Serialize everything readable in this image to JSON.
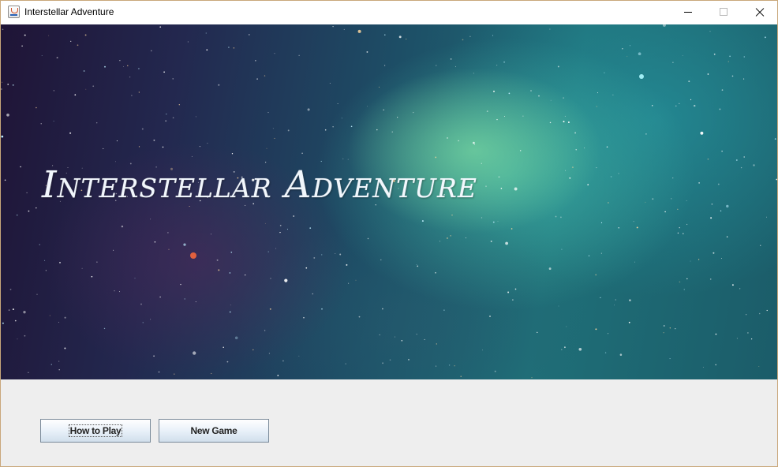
{
  "window": {
    "title": "Interstellar Adventure",
    "icon": "java-cup-icon",
    "controls": [
      "minimize-icon",
      "maximize-icon",
      "close-icon"
    ]
  },
  "banner": {
    "title": "Interstellar Adventure",
    "background": "starry-nebula-image"
  },
  "menu": {
    "how_to_play_label": "How to Play",
    "new_game_label": "New Game"
  },
  "colors": {
    "panel": "#eeeeee",
    "title_text": "#f5faff",
    "window_border": "#c9a77a"
  }
}
